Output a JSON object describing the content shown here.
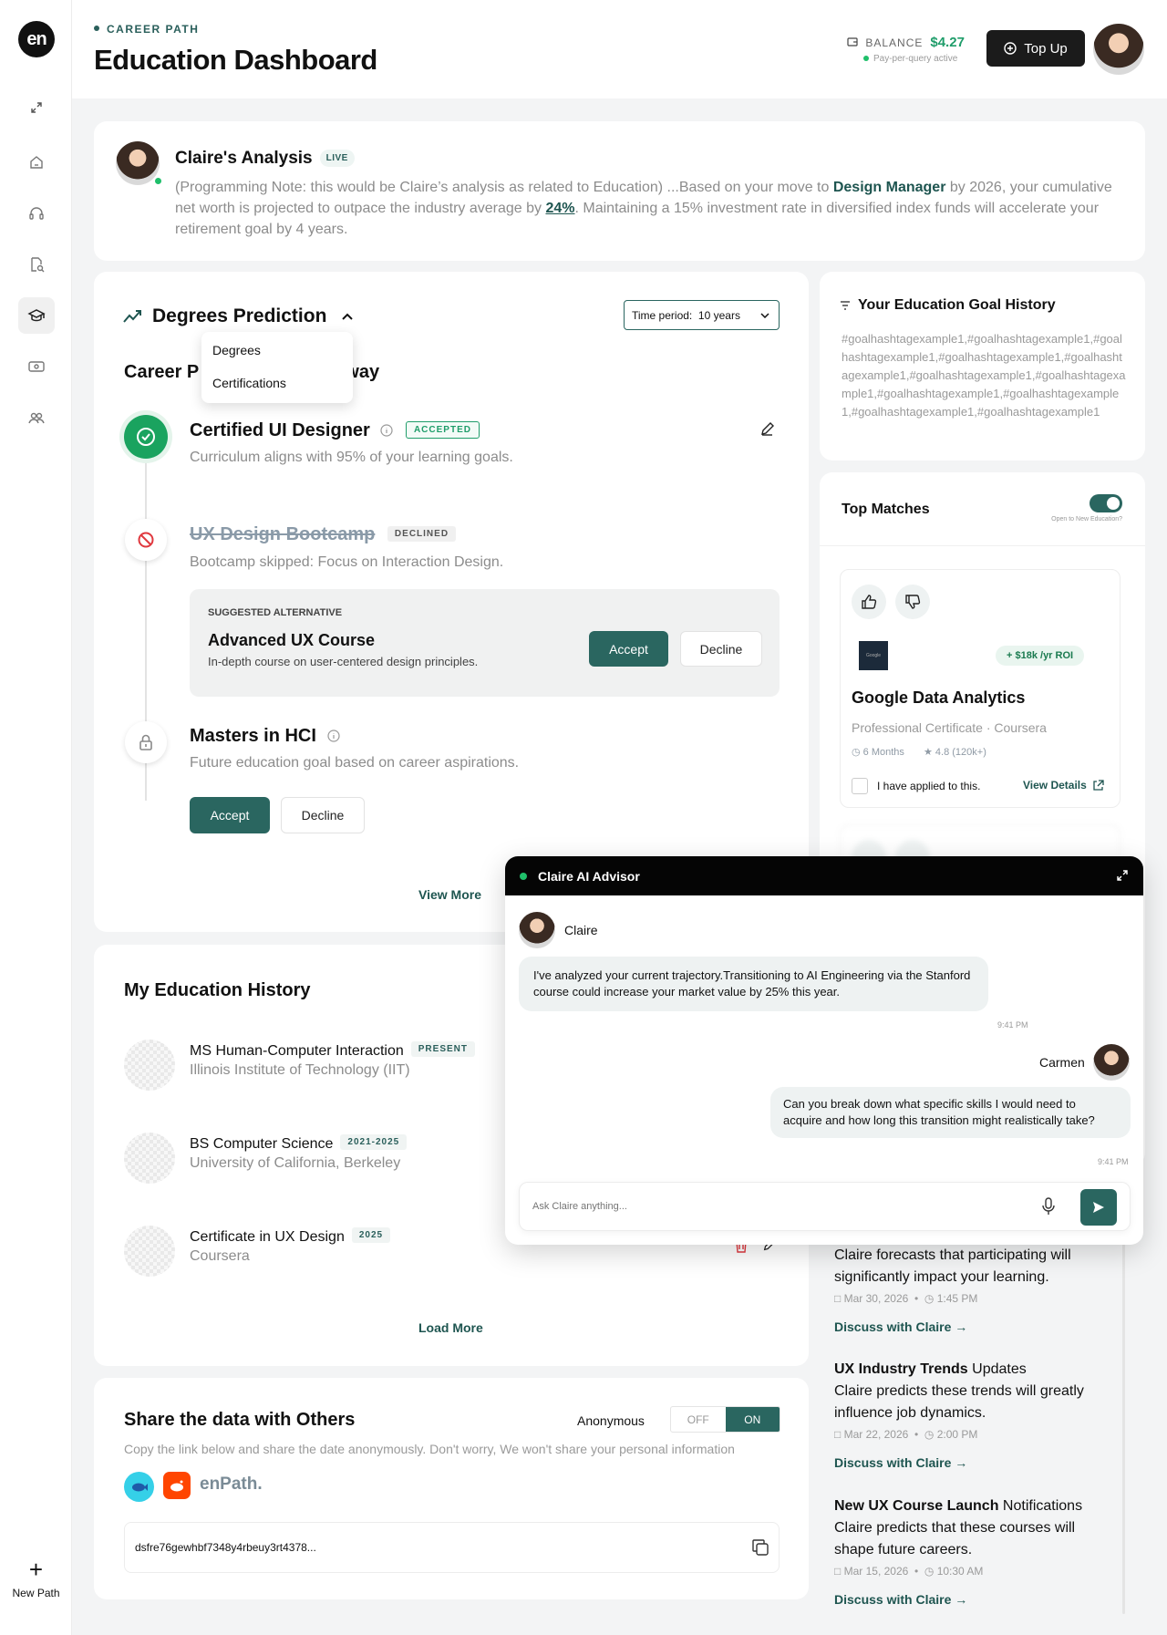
{
  "sidebar": {
    "logo": "en",
    "new_path_label": "New Path",
    "icons": [
      "expand-icon",
      "home-icon",
      "headset-icon",
      "search-file-icon",
      "graduation-cap-icon",
      "money-icon",
      "team-icon"
    ]
  },
  "header": {
    "eyebrow": "CAREER PATH",
    "title": "Education Dashboard",
    "balance_label": "BALANCE",
    "balance_amount": "$4.27",
    "balance_sub": "Pay-per-query active",
    "topup_label": "Top Up"
  },
  "analysis": {
    "title": "Claire's Analysis",
    "badge": "LIVE",
    "text_1": "(Programming Note: this would be Claire’s analysis as related to Education) ...Based on your move to ",
    "highlight_role": "Design Manager",
    "text_2": " by 2026, your cumulative net worth is projected to outpace the industry average by ",
    "highlight_pct": "24%",
    "text_3": ". Maintaining a 15% investment rate in diversified index funds will accelerate your retirement goal by 4 years."
  },
  "prediction": {
    "title": "Degrees Prediction",
    "time_period_label": "Time period:",
    "time_period_value": "10 years",
    "dropdown_items": [
      "Degrees",
      "Certifications"
    ],
    "section_title_left": "Career P",
    "section_title_right": "way",
    "items": [
      {
        "title": "Certified UI Designer",
        "badge": "ACCEPTED",
        "desc": "Curriculum aligns with 95% of your learning goals."
      },
      {
        "title": "UX Design Bootcamp",
        "badge": "DECLINED",
        "desc": "Bootcamp skipped: Focus on Interaction Design."
      },
      {
        "title": "Masters in HCI",
        "desc": "Future education goal based on career aspirations."
      }
    ],
    "suggested": {
      "label": "SUGGESTED ALTERNATIVE",
      "title": "Advanced UX Course",
      "desc": "In-depth course on user-centered design principles."
    },
    "accept_label": "Accept",
    "decline_label": "Decline",
    "view_more": "View More"
  },
  "goal_history": {
    "title": "Your Education Goal History",
    "text": "#goalhashtagexample1,#goalhashtagexample1,#goalhashtagexample1,#goalhashtagexample1,#goalhashtagexample1,#goalhashtagexample1,#goalhashtagexample1,#goalhashtagexample1,#goalhashtagexample1,#goalhashtagexample1,#goalhashtagexample1"
  },
  "top_matches": {
    "title": "Top Matches",
    "toggle_label": "Open to New Education?",
    "card": {
      "roi": "+ $18k /yr ROI",
      "logo_text": "Google",
      "title": "Google Data Analytics",
      "subtitle": "Professional Certificate · Coursera",
      "duration": "6 Months",
      "rating": "4.8 (120k+)",
      "applied_label": "I have applied to this.",
      "view_details": "View Details"
    }
  },
  "history": {
    "title": "My Education History",
    "items": [
      {
        "title": "MS Human-Computer Interaction",
        "badge": "PRESENT",
        "school": "Illinois Institute of Technology (IIT)"
      },
      {
        "title": "BS Computer Science",
        "badge": "2021-2025",
        "school": "University of California, Berkeley"
      },
      {
        "title": "Certificate in UX Design",
        "badge": "2025",
        "school": "Coursera"
      }
    ],
    "load_more": "Load More"
  },
  "share": {
    "title": "Share the data with Others",
    "anonymous_label": "Anonymous",
    "off_label": "OFF",
    "on_label": "ON",
    "desc": "Copy the link below and share the date anonymously. Don't worry, We won't share your personal information",
    "brand": "enPath.",
    "link": "dsfre76gewhbf7348y4rbeuy3rt4378..."
  },
  "news": {
    "items": [
      {
        "title_bold": "",
        "title_rest": "",
        "body": "Claire forecasts that participating will significantly impact your learning.",
        "date": "Mar 30, 2026",
        "time": "1:45 PM",
        "link": "Discuss with Claire"
      },
      {
        "title_bold": "UX Industry Trends",
        "title_rest": " Updates",
        "body": "Claire predicts these trends will greatly influence job dynamics.",
        "date": "Mar 22, 2026",
        "time": "2:00 PM",
        "link": "Discuss with Claire"
      },
      {
        "title_bold": "New UX Course Launch",
        "title_rest": " Notifications",
        "body": "Claire predicts that these courses will shape future careers.",
        "date": "Mar 15, 2026",
        "time": "10:30 AM",
        "link": "Discuss with Claire"
      }
    ]
  },
  "chat": {
    "title": "Claire AI Advisor",
    "advisor_name": "Claire",
    "advisor_msg": "I've analyzed your current trajectory.Transitioning to AI Engineering via the Stanford course could increase your market value by 25% this year.",
    "advisor_time": "9:41 PM",
    "user_name": "Carmen",
    "user_msg": "Can you break down what specific skills I would need to acquire and how long this transition might realistically take?",
    "user_time": "9:41 PM",
    "input_placeholder": "Ask Claire anything..."
  },
  "colors": {
    "accent": "#2a6660",
    "positive": "#1f9d6a",
    "danger": "#e0383e"
  }
}
